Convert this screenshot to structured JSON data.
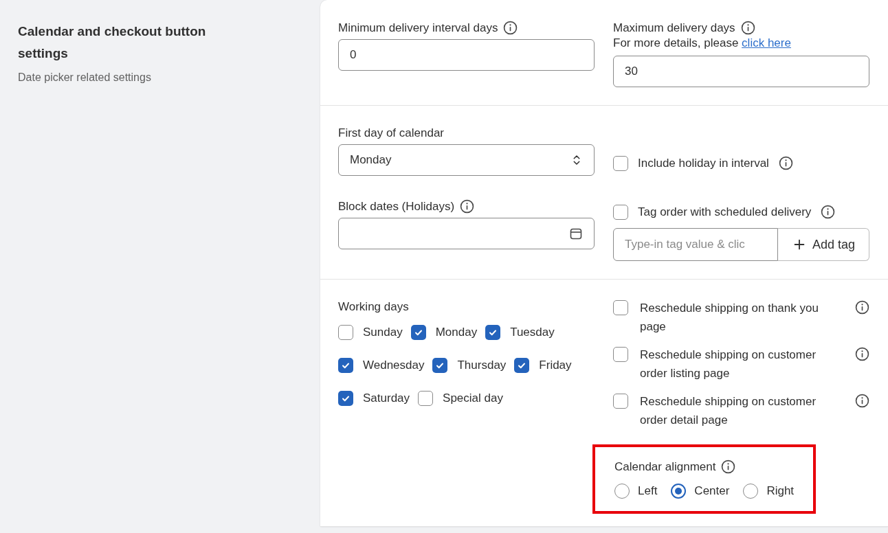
{
  "sidebar": {
    "title": "Calendar and checkout button settings",
    "subtitle": "Date picker related settings"
  },
  "min_interval": {
    "label": "Minimum delivery interval days",
    "value": "0"
  },
  "max_days": {
    "label": "Maximum delivery days",
    "hint": "For more details, please",
    "link": "click here",
    "value": "30"
  },
  "first_day": {
    "label": "First day of calendar",
    "value": "Monday"
  },
  "include_holiday": {
    "label": "Include holiday in interval",
    "checked": false
  },
  "block_dates": {
    "label": "Block dates (Holidays)"
  },
  "tag_order": {
    "label": "Tag order with scheduled delivery",
    "checked": false,
    "placeholder": "Type-in tag value & clic",
    "button": "Add tag"
  },
  "working_days": {
    "label": "Working days",
    "rows": [
      [
        {
          "label": "Sunday",
          "checked": false
        },
        {
          "label": "Monday",
          "checked": true
        },
        {
          "label": "Tuesday",
          "checked": true
        }
      ],
      [
        {
          "label": "Wednesday",
          "checked": true
        },
        {
          "label": "Thursday",
          "checked": true
        },
        {
          "label": "Friday",
          "checked": true
        }
      ],
      [
        {
          "label": "Saturday",
          "checked": true
        },
        {
          "label": "Special day",
          "checked": false
        }
      ]
    ]
  },
  "reschedule": [
    {
      "label": "Reschedule shipping on thank you page",
      "checked": false
    },
    {
      "label": "Reschedule shipping on customer order listing page",
      "checked": false
    },
    {
      "label": "Reschedule shipping on customer order detail page",
      "checked": false
    }
  ],
  "calendar_alignment": {
    "label": "Calendar alignment",
    "highlighted": true,
    "options": [
      {
        "label": "Left",
        "selected": false
      },
      {
        "label": "Center",
        "selected": true
      },
      {
        "label": "Right",
        "selected": false
      }
    ]
  }
}
